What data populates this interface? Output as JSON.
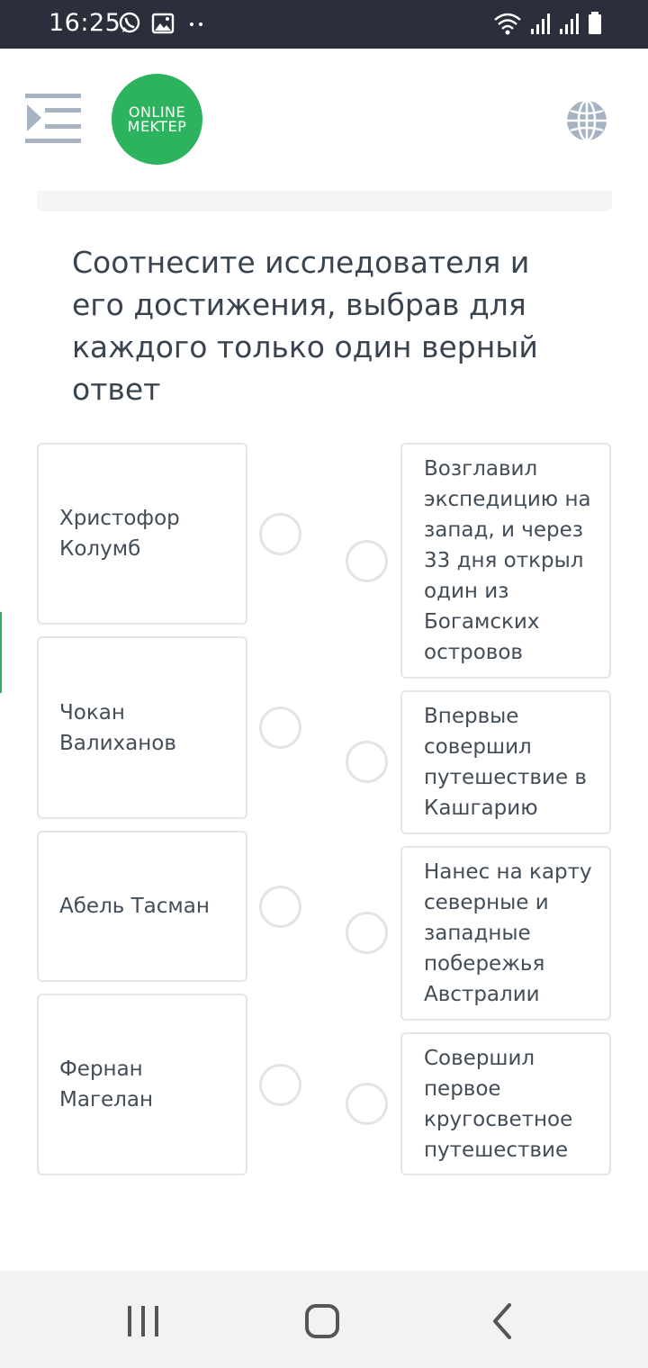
{
  "status_bar": {
    "time": "16:25",
    "icons_left": [
      "whatsapp-icon",
      "gallery-icon",
      "more-dots-icon"
    ],
    "icons_right": [
      "wifi-icon",
      "signal-icon",
      "signal-icon",
      "battery-icon"
    ]
  },
  "header": {
    "logo_line1": "ONLINE",
    "logo_line2": "MEKTEP",
    "brand_color": "#2db35d"
  },
  "question": {
    "text": "Соотнесите исследователя и его достижения, выбрав для каждого только один верный ответ"
  },
  "left_items": [
    {
      "label": "Христофор Колумб"
    },
    {
      "label": "Чокан Валиханов"
    },
    {
      "label": "Абель Тасман"
    },
    {
      "label": "Фернан Магелан"
    }
  ],
  "right_items": [
    {
      "label": "Возглавил экспедицию на запад, и через 33 дня открыл один из Богамских островов"
    },
    {
      "label": "Впервые совершил путешествие в Кашгарию"
    },
    {
      "label": "Нанес на карту северные и западные побережья Австралии"
    },
    {
      "label": "Совершил первое кругосветное путешествие"
    }
  ],
  "nav_bar": {
    "buttons": [
      "recent-apps-icon",
      "home-icon",
      "back-icon"
    ]
  }
}
